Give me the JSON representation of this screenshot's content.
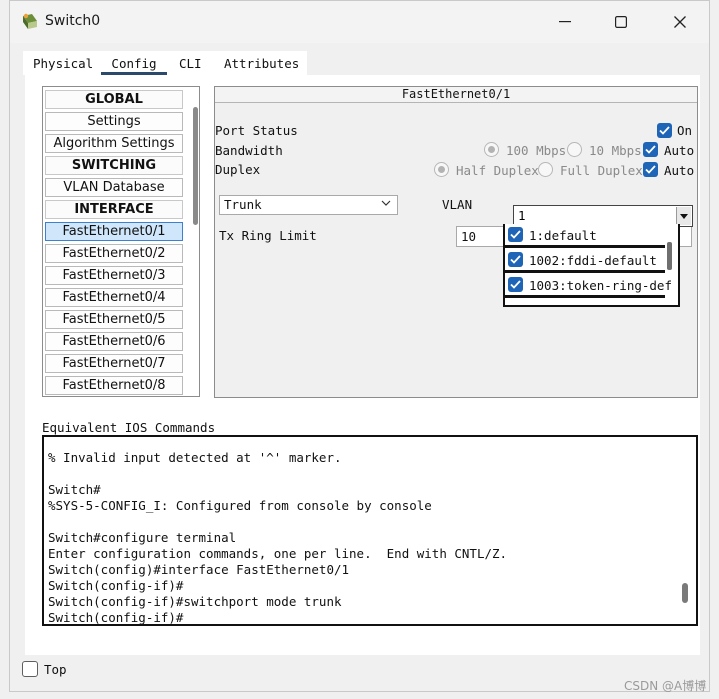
{
  "window": {
    "title": "Switch0"
  },
  "tabs": [
    {
      "label": "Physical"
    },
    {
      "label": "Config",
      "active": true
    },
    {
      "label": "CLI"
    },
    {
      "label": "Attributes"
    }
  ],
  "sidebar": {
    "items": [
      {
        "label": "GLOBAL",
        "type": "header"
      },
      {
        "label": "Settings"
      },
      {
        "label": "Algorithm Settings"
      },
      {
        "label": "SWITCHING",
        "type": "header"
      },
      {
        "label": "VLAN Database"
      },
      {
        "label": "INTERFACE",
        "type": "header"
      },
      {
        "label": "FastEthernet0/1",
        "selected": true
      },
      {
        "label": "FastEthernet0/2"
      },
      {
        "label": "FastEthernet0/3"
      },
      {
        "label": "FastEthernet0/4"
      },
      {
        "label": "FastEthernet0/5"
      },
      {
        "label": "FastEthernet0/6"
      },
      {
        "label": "FastEthernet0/7"
      },
      {
        "label": "FastEthernet0/8"
      }
    ]
  },
  "interface_panel": {
    "title": "FastEthernet0/1",
    "port_status_label": "Port Status",
    "port_status_on_label": "On",
    "port_status_on": true,
    "bandwidth_label": "Bandwidth",
    "bandwidth_100": "100 Mbps",
    "bandwidth_10": "10 Mbps",
    "bandwidth_auto": "Auto",
    "bandwidth_auto_checked": true,
    "duplex_label": "Duplex",
    "duplex_half": "Half Duplex",
    "duplex_full": "Full Duplex",
    "duplex_auto": "Auto",
    "duplex_auto_checked": true,
    "mode_value": "Trunk",
    "vlan_label": "VLAN",
    "vlan_value": "1",
    "vlan_options": [
      {
        "label": "1:default",
        "checked": true
      },
      {
        "label": "1002:fddi-default",
        "checked": true
      },
      {
        "label": "1003:token-ring-def",
        "checked": true
      }
    ],
    "tx_ring_label": "Tx Ring Limit",
    "tx_ring_value": "10"
  },
  "ios": {
    "label": "Equivalent IOS Commands",
    "lines": [
      "% Invalid input detected at '^' marker.",
      "",
      "Switch#",
      "%SYS-5-CONFIG_I: Configured from console by console",
      "",
      "Switch#configure terminal",
      "Enter configuration commands, one per line.  End with CNTL/Z.",
      "Switch(config)#interface FastEthernet0/1",
      "Switch(config-if)#",
      "Switch(config-if)#switchport mode trunk",
      "Switch(config-if)#"
    ]
  },
  "footer": {
    "top_label": "Top",
    "top_checked": false,
    "watermark": "CSDN @A博博"
  },
  "colors": {
    "accent": "#1f65b7",
    "selected_bg": "#cfe6fb",
    "tab_underline": "#2b4a6b"
  }
}
